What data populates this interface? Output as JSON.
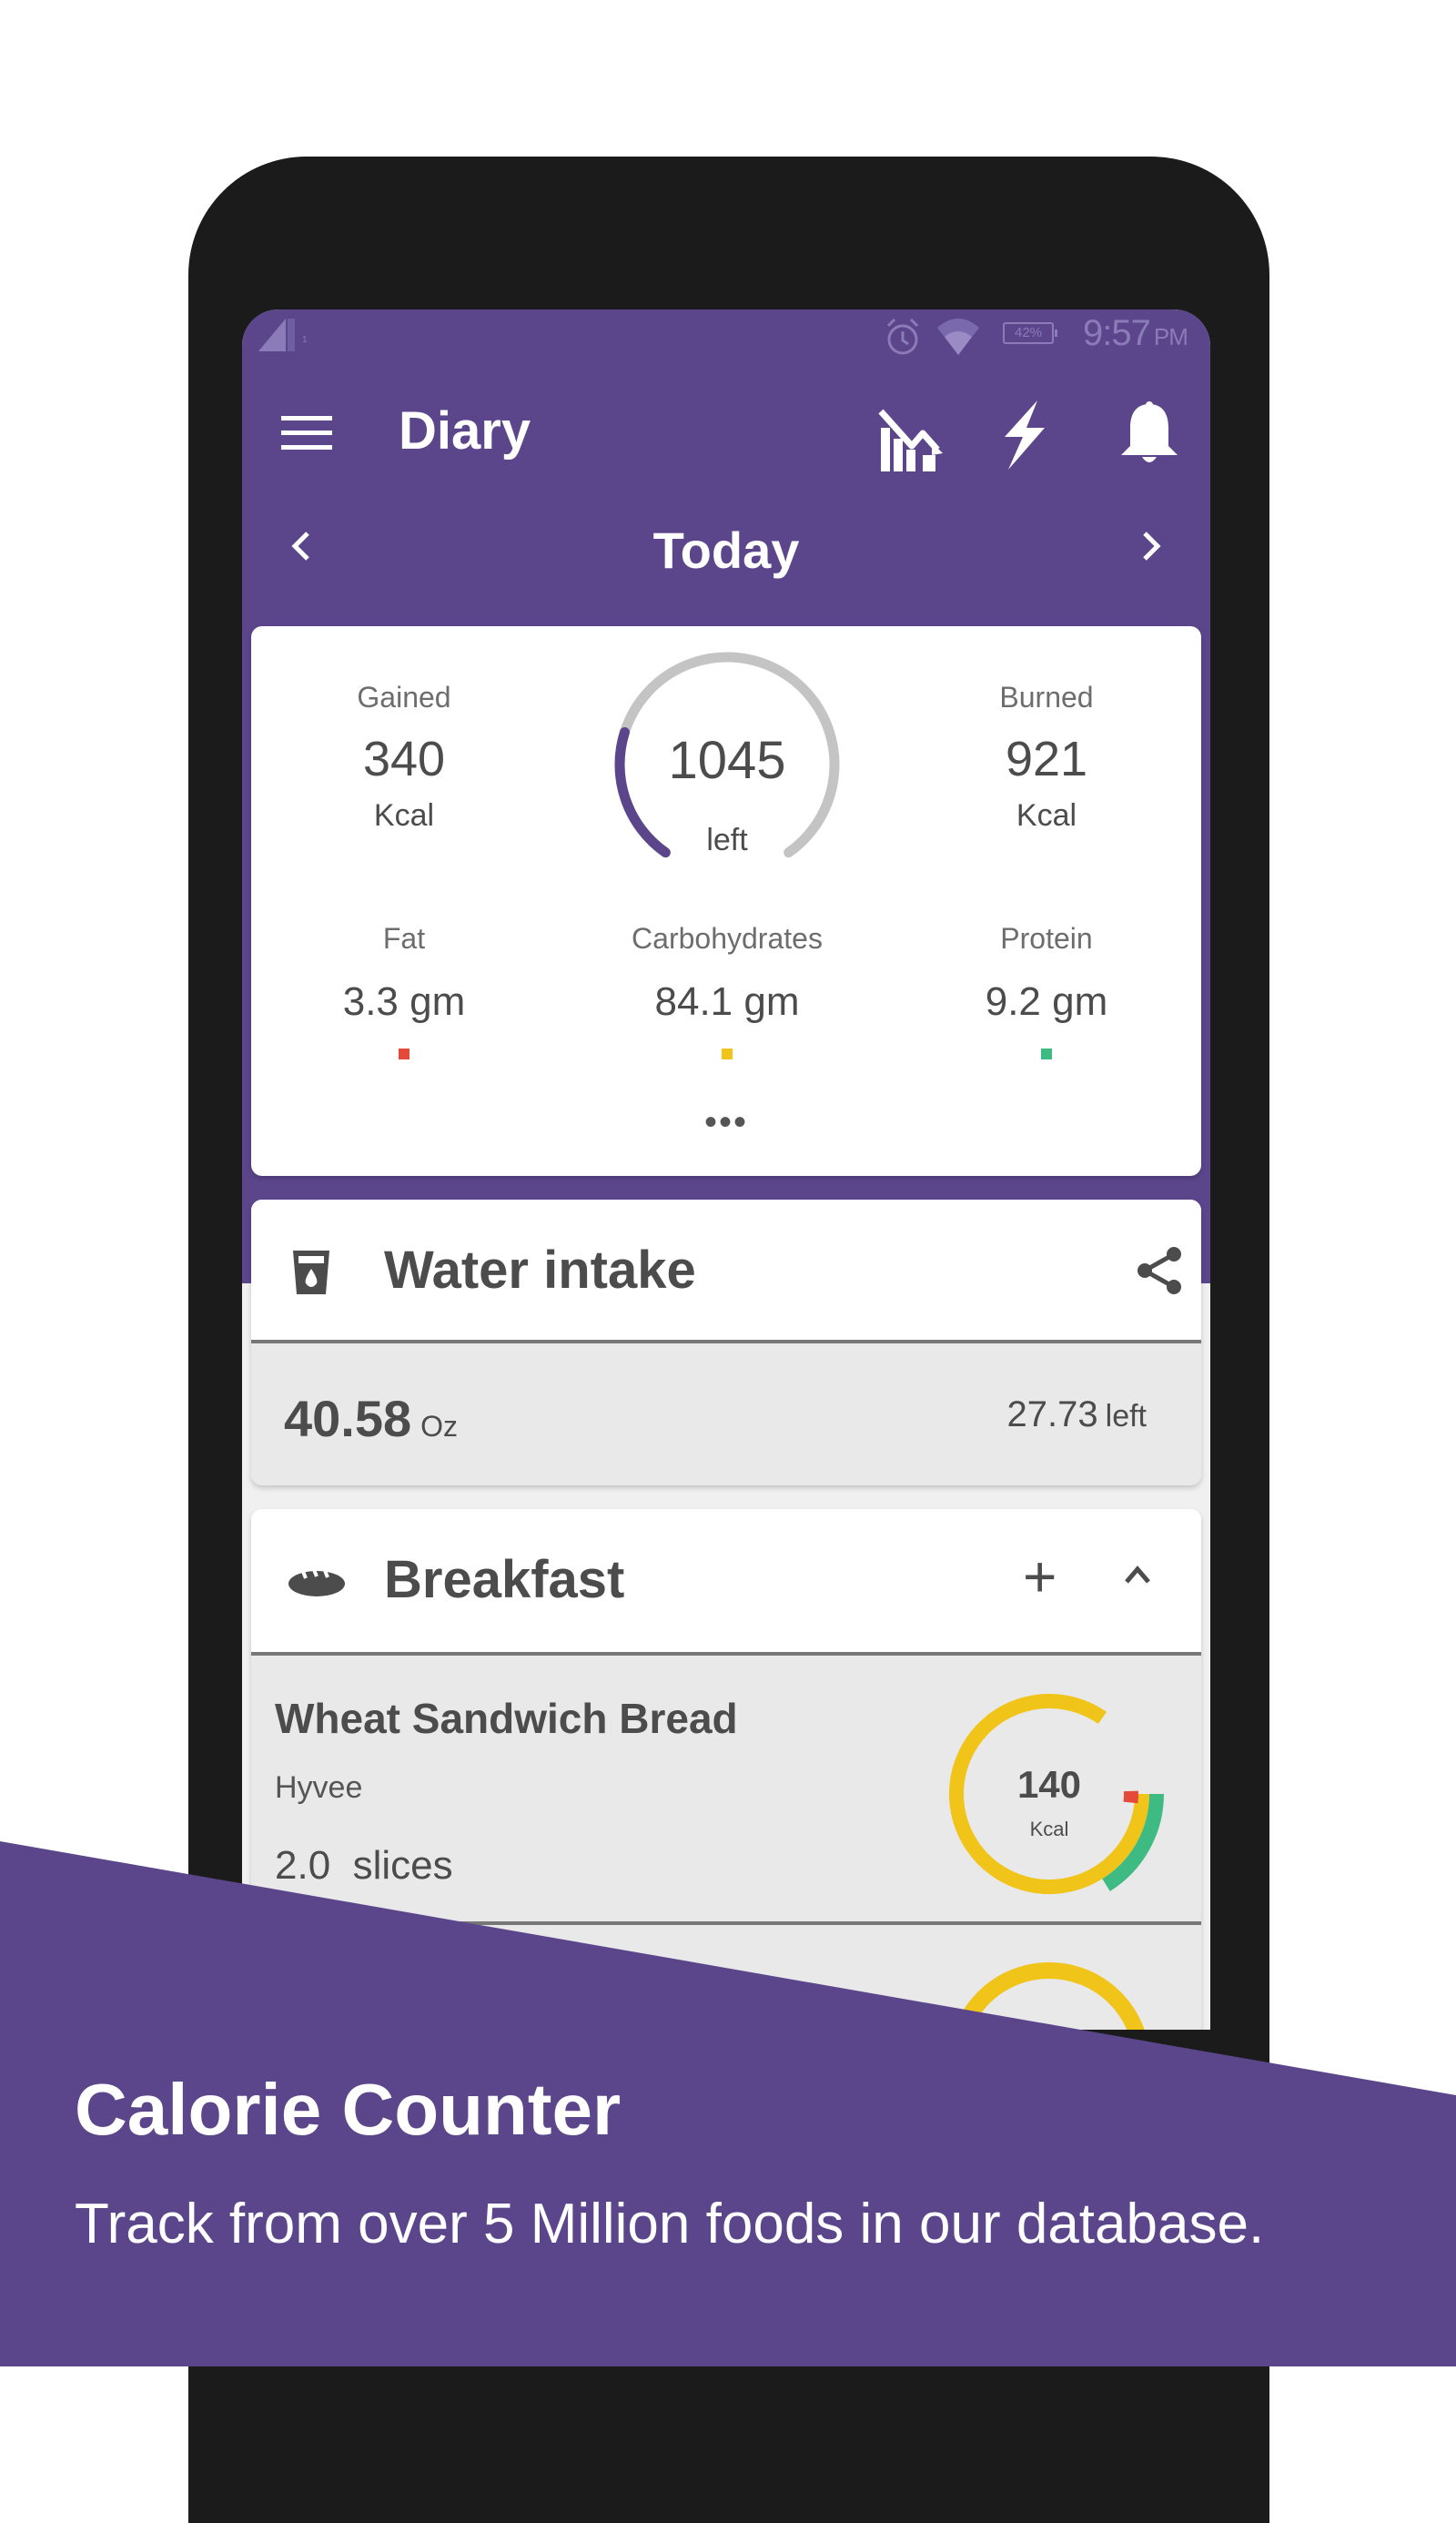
{
  "status_bar": {
    "carrier_indicator": "1",
    "battery": "42%",
    "time": "9:57",
    "ampm": "PM"
  },
  "toolbar": {
    "title": "Diary",
    "icons": [
      "menu-icon",
      "chart-trend-icon",
      "bolt-icon",
      "bell-icon"
    ]
  },
  "date_nav": {
    "label": "Today",
    "prev_icon": "chevron-left-icon",
    "next_icon": "chevron-right-icon"
  },
  "summary": {
    "gained": {
      "label": "Gained",
      "value": "340",
      "unit": "Kcal"
    },
    "burned": {
      "label": "Burned",
      "value": "921",
      "unit": "Kcal"
    },
    "remaining": {
      "value": "1045",
      "label": "left",
      "progress_fraction": 0.25
    },
    "macros": [
      {
        "label": "Fat",
        "value": "3.3 gm",
        "color": "#e5493a"
      },
      {
        "label": "Carbohydrates",
        "value": "84.1 gm",
        "color": "#f0c419"
      },
      {
        "label": "Protein",
        "value": "9.2 gm",
        "color": "#3dbb82"
      }
    ],
    "more": "•••"
  },
  "water": {
    "title": "Water intake",
    "amount": "40.58",
    "unit": "Oz",
    "left_value": "27.73",
    "left_label": "left"
  },
  "breakfast": {
    "title": "Breakfast",
    "add_label": "+",
    "items": [
      {
        "name": "Wheat Sandwich Bread",
        "brand": "Hyvee",
        "quantity": "2.0  slices",
        "kcal": "140",
        "kcal_unit": "Kcal"
      }
    ]
  },
  "colors": {
    "brand_purple": "#5b468c",
    "gauge_track": "#c4c4c4",
    "fat": "#e5493a",
    "carbs": "#f0c419",
    "protein": "#3dbb82"
  },
  "promo": {
    "title": "Calorie Counter",
    "subtitle": "Track from over 5 Million foods in our database."
  }
}
